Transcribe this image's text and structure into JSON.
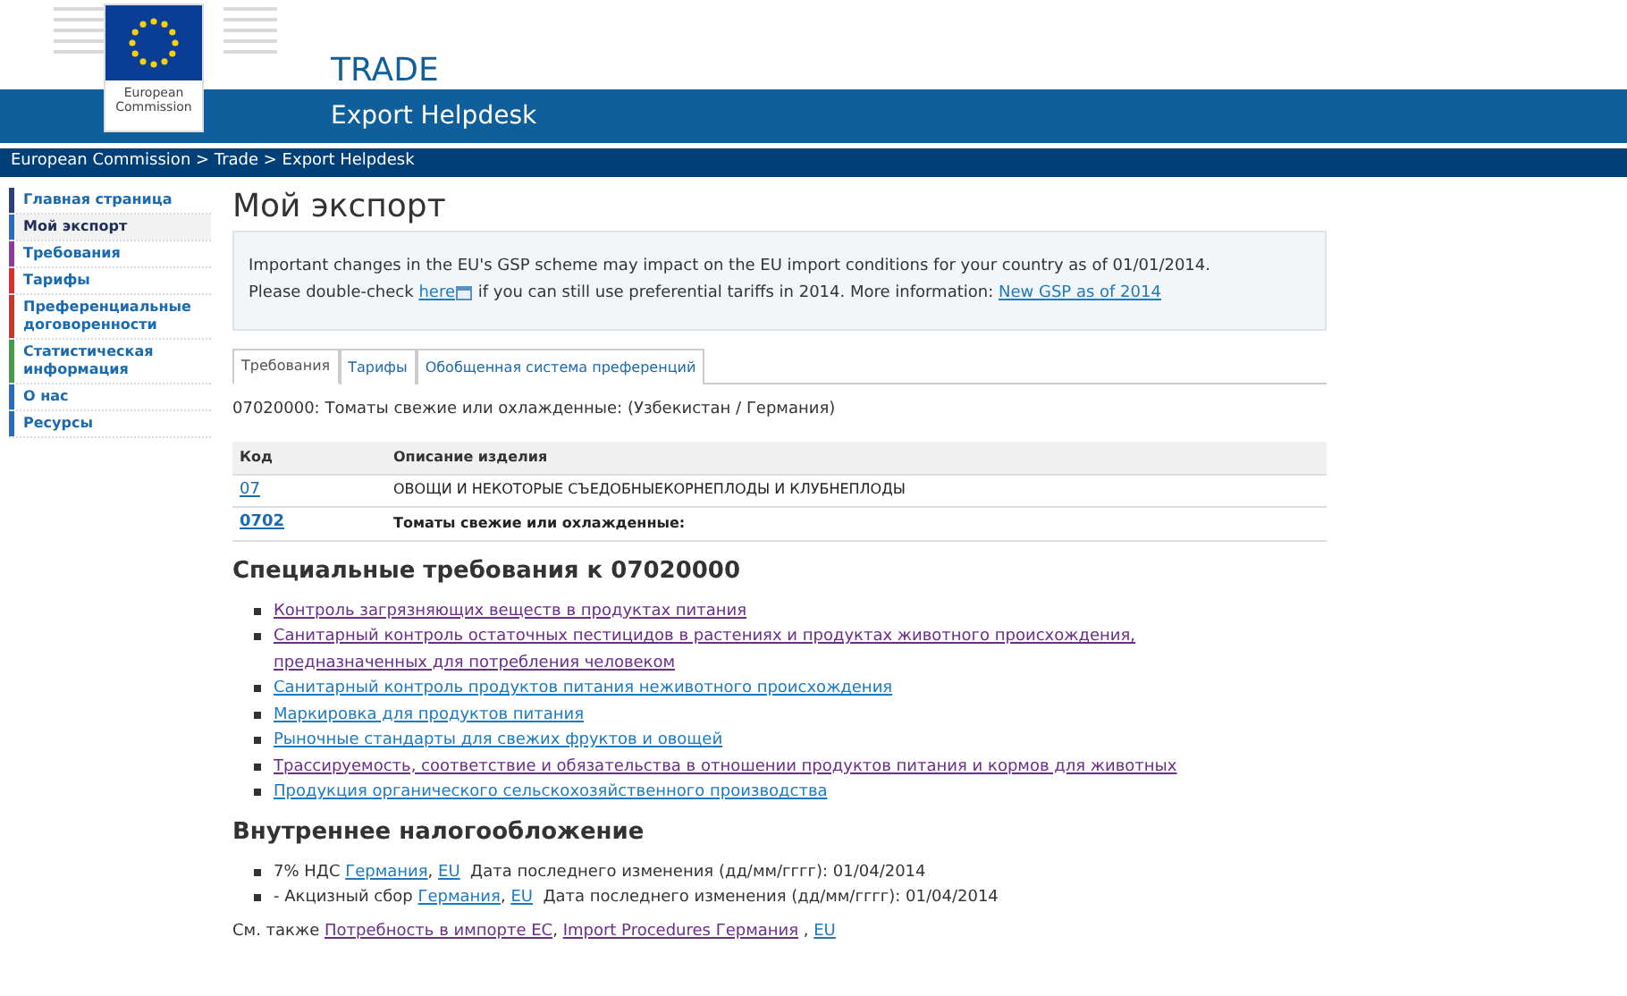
{
  "header": {
    "logo_text": "European Commission",
    "title": "TRADE",
    "subtitle": "Export Helpdesk"
  },
  "breadcrumb": "European Commission > Trade > Export Helpdesk",
  "sidebar": {
    "items": [
      {
        "label": "Главная страница",
        "selected": false,
        "color": "#2b3f7e"
      },
      {
        "label": "Мой экспорт",
        "selected": true,
        "color": "#2a6db4"
      },
      {
        "label": "Требования",
        "selected": false,
        "color": "#8e3a9c"
      },
      {
        "label": "Тарифы",
        "selected": false,
        "color": "#d9302c"
      },
      {
        "label": "Преференциальные договоренности",
        "selected": false,
        "color": "#c8372e"
      },
      {
        "label": "Статистическая информация",
        "selected": false,
        "color": "#4a9a4a"
      },
      {
        "label": "О нас",
        "selected": false,
        "color": "#2a6db4"
      },
      {
        "label": "Ресурсы",
        "selected": false,
        "color": "#2a6db4"
      }
    ]
  },
  "page_title": "Мой экспорт",
  "notice": {
    "lines": [
      [
        {
          "kind": "text",
          "text": "Important changes in the EU's GSP scheme may impact on the EU import conditions for your country as of 01/01/2014."
        }
      ],
      [
        {
          "kind": "text",
          "text": "Please double-check "
        },
        {
          "kind": "link",
          "text": "here",
          "visited": false,
          "popup": true
        },
        {
          "kind": "text",
          "text": " if you can still use preferential tariffs in 2014. More information: "
        },
        {
          "kind": "link",
          "text": "New GSP as of 2014",
          "visited": false
        }
      ]
    ]
  },
  "tabs": [
    {
      "label": "Требования",
      "selected": true
    },
    {
      "label": "Тарифы",
      "selected": false
    },
    {
      "label": "Обобщенная система преференций",
      "selected": false
    }
  ],
  "product_line": "07020000: Томаты свежие или охлажденные: (Узбекистан / Германия)",
  "table": {
    "columns": [
      "Код",
      "Описание изделия"
    ],
    "rows": [
      {
        "code": "07",
        "description": "ОВОЩИ И НЕКОТОРЫЕ СЪЕДОБНЫЕКОРНЕПЛОДЫ И КЛУБНЕПЛОДЫ",
        "emphasis": false
      },
      {
        "code": "0702",
        "description": "Томаты свежие или охлажденные:",
        "emphasis": true
      }
    ]
  },
  "requirements": {
    "heading": "Специальные требования к 07020000",
    "links": [
      {
        "text": "Контроль загрязняющих веществ в продуктах питания",
        "visited": true
      },
      {
        "text": "Санитарный контроль остаточных пестицидов в растениях и продуктах животного происхождения, предназначенных для потребления человеком",
        "visited": true
      },
      {
        "text": "Санитарный контроль продуктов питания неживотного происхождения",
        "visited": false
      },
      {
        "text": "Маркировка для продуктов питания",
        "visited": false
      },
      {
        "text": "Рыночные стандарты для свежих фруктов и овощей",
        "visited": false
      },
      {
        "text": "Трассируемость, соответствие и обязательства в отношении продуктов питания и кормов для животных",
        "visited": true
      },
      {
        "text": "Продукция органического сельскохозяйственного производства",
        "visited": false
      }
    ]
  },
  "taxation": {
    "heading": "Внутреннее налогообложение",
    "items": [
      [
        {
          "kind": "text",
          "text": "7% НДС "
        },
        {
          "kind": "link",
          "text": "Германия",
          "visited": false
        },
        {
          "kind": "text",
          "text": ", "
        },
        {
          "kind": "link",
          "text": "EU",
          "visited": false
        },
        {
          "kind": "text",
          "text": "  Дата последнего изменения (дд/мм/гггг): 01/04/2014"
        }
      ],
      [
        {
          "kind": "text",
          "text": "- Акцизный сбор "
        },
        {
          "kind": "link",
          "text": "Германия",
          "visited": false
        },
        {
          "kind": "text",
          "text": ", "
        },
        {
          "kind": "link",
          "text": "EU",
          "visited": false
        },
        {
          "kind": "text",
          "text": "  Дата последнего изменения (дд/мм/гггг): 01/04/2014"
        }
      ]
    ]
  },
  "see_also": [
    {
      "kind": "text",
      "text": "См. также "
    },
    {
      "kind": "link",
      "text": "Потребность в импорте ЕС",
      "visited": true
    },
    {
      "kind": "text",
      "text": ", "
    },
    {
      "kind": "link",
      "text": "Import Procedures Германия",
      "visited": true
    },
    {
      "kind": "text",
      "text": " , "
    },
    {
      "kind": "link",
      "text": "EU",
      "visited": false
    }
  ]
}
